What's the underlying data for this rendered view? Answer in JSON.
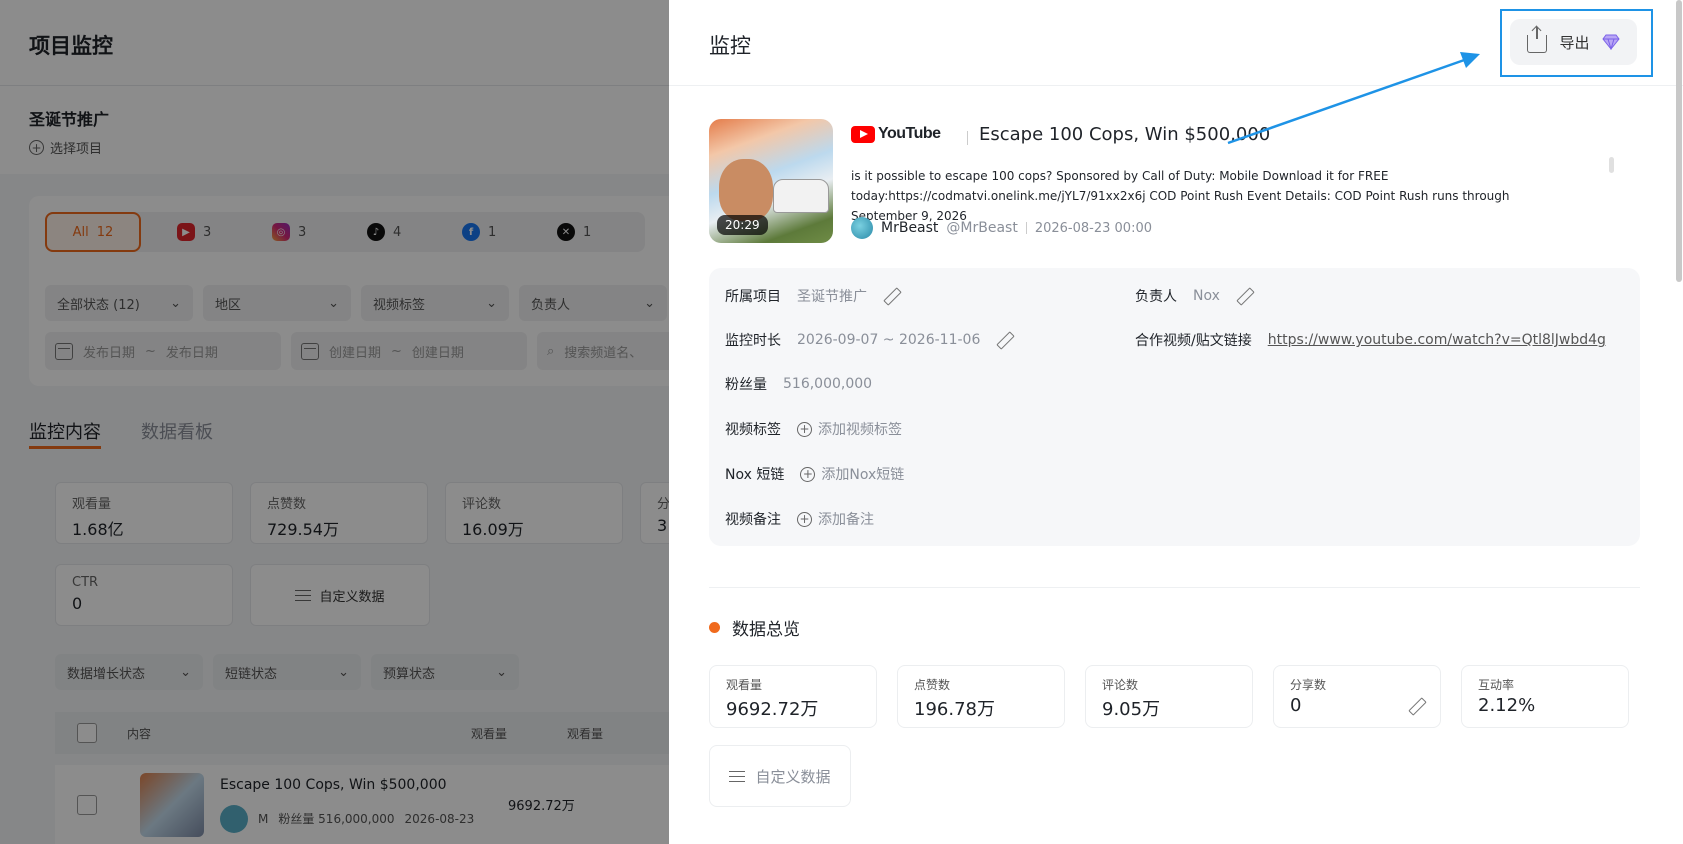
{
  "background": {
    "page_title": "项目监控",
    "project_name": "圣诞节推广",
    "select_project": "选择项目",
    "platforms": [
      {
        "label": "All",
        "count": "12"
      },
      {
        "label": "youtube",
        "count": "3"
      },
      {
        "label": "instagram",
        "count": "3"
      },
      {
        "label": "tiktok",
        "count": "4"
      },
      {
        "label": "facebook",
        "count": "1"
      },
      {
        "label": "x",
        "count": "1"
      }
    ],
    "filters": [
      "全部状态 (12)",
      "地区",
      "视频标签",
      "负责人"
    ],
    "date_filters": {
      "publish_start": "发布日期",
      "publish_end": "发布日期",
      "create_start": "创建日期",
      "create_end": "创建日期",
      "tilde": "~",
      "search_placeholder": "搜索频道名、"
    },
    "tabs": [
      "监控内容",
      "数据看板"
    ],
    "stats": [
      {
        "label": "观看量",
        "value": "1.68亿"
      },
      {
        "label": "点赞数",
        "value": "729.54万"
      },
      {
        "label": "评论数",
        "value": "16.09万"
      },
      {
        "label": "分",
        "value": "3"
      },
      {
        "label": "CTR",
        "value": "0"
      }
    ],
    "custom_data": "自定义数据",
    "filters2": [
      "数据增长状态",
      "短链状态",
      "预算状态"
    ],
    "table_headers": [
      "内容",
      "观看量",
      "观看量"
    ],
    "row": {
      "title": "Escape 100 Cops, Win $500,000",
      "author_short": "M",
      "fans": "粉丝量 516,000,000",
      "date": "2026-08-23",
      "views": "9692.72万"
    }
  },
  "drawer": {
    "title": "监控",
    "export_label": "导出",
    "video": {
      "platform": "YouTube",
      "title": "Escape 100 Cops, Win $500,000",
      "description": "is it possible to escape 100 cops? Sponsored by Call of Duty: Mobile Download it for FREE today:https://codmatvi.onelink.me/jYL7/91xx2x6j COD Point Rush Event Details: COD Point Rush runs through September 9, 2026",
      "duration": "20:29",
      "author": "MrBeast",
      "handle": "@MrBeast",
      "published": "2026-08-23 00:00"
    },
    "info": {
      "project_label": "所属项目",
      "project_value": "圣诞节推广",
      "owner_label": "负责人",
      "owner_value": "Nox",
      "period_label": "监控时长",
      "period_value": "2026-09-07 ~ 2026-11-06",
      "link_label": "合作视频/贴文链接",
      "link_value": "https://www.youtube.com/watch?v=Qtl8lJwbd4g",
      "fans_label": "粉丝量",
      "fans_value": "516,000,000",
      "tags_label": "视频标签",
      "tags_add": "添加视频标签",
      "shortlink_label": "Nox 短链",
      "shortlink_add": "添加Nox短链",
      "note_label": "视频备注",
      "note_add": "添加备注"
    },
    "overview_title": "数据总览",
    "metrics": [
      {
        "label": "观看量",
        "value": "9692.72万"
      },
      {
        "label": "点赞数",
        "value": "196.78万"
      },
      {
        "label": "评论数",
        "value": "9.05万"
      },
      {
        "label": "分享数",
        "value": "0"
      },
      {
        "label": "互动率",
        "value": "2.12%"
      }
    ],
    "custom_data": "自定义数据"
  },
  "colors": {
    "accent": "#f06a1d",
    "highlight": "#1e93e6",
    "youtube": "#ff0000"
  },
  "icons": [
    "upload-icon",
    "gem-icon",
    "pencil-icon",
    "plus-circle-icon",
    "calendar-icon",
    "search-icon",
    "sliders-icon",
    "chevron-down-icon"
  ]
}
